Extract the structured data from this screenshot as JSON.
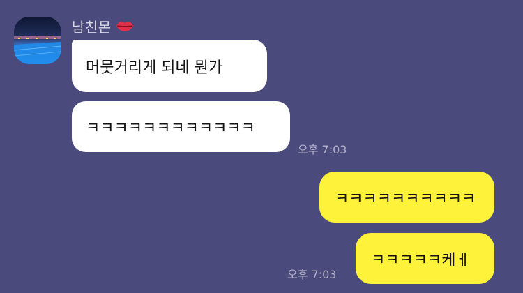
{
  "sender": {
    "name": "남친몬",
    "badge_icon": "lips-icon"
  },
  "messages": [
    {
      "direction": "incoming",
      "text": "머뭇거리게 되네 뭔가"
    },
    {
      "direction": "incoming",
      "text": "ㅋㅋㅋㅋㅋㅋㅋㅋㅋㅋㅋㅋ",
      "time": "오후 7:03"
    },
    {
      "direction": "outgoing",
      "text": "ㅋㅋㅋㅋㅋㅋㅋㅋㅋㅋ"
    },
    {
      "direction": "outgoing",
      "text": "ㅋㅋㅋㅋㅋ케ㅔ",
      "time": "오후 7:03"
    }
  ],
  "colors": {
    "background": "#4b4a7c",
    "incoming_bubble": "#ffffff",
    "outgoing_bubble": "#fff23a"
  }
}
